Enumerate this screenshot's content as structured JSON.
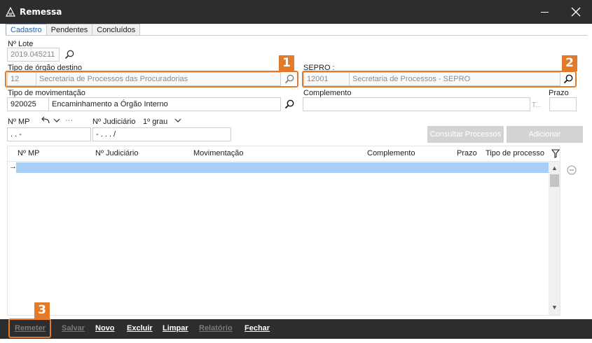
{
  "window": {
    "title": "Remessa"
  },
  "tabs": [
    "Cadastro",
    "Pendentes",
    "Concluídos"
  ],
  "lote": {
    "label": "Nº Lote",
    "value": "2019.045211"
  },
  "orgao": {
    "label": "Tipo de órgão destino",
    "code": "12",
    "name": "Secretaria de Processos das Procuradorias"
  },
  "sepro": {
    "label": "SEPRO :",
    "code": "12001",
    "name": "Secretaria de Processos - SEPRO"
  },
  "movimentacao": {
    "label": "Tipo de movimentação",
    "code": "920025",
    "name": "Encaminhamento a Órgão Interno"
  },
  "complemento": {
    "label": "Complemento",
    "hint": "T..."
  },
  "prazo": {
    "label": "Prazo"
  },
  "mp": {
    "label": "Nº MP",
    "mask": " .   .      -",
    "more": "···"
  },
  "judiciario": {
    "label": "Nº Judiciário",
    "grau": "1º grau",
    "mask": "          -  .  .  .   /"
  },
  "actions": {
    "consultar": "Consultar Processos",
    "adicionar": "Adicionar"
  },
  "grid": {
    "columns": [
      "Nº MP",
      "Nº Judiciário",
      "Movimentação",
      "Complemento",
      "Prazo",
      "Tipo de processo"
    ],
    "row_indicator": "→"
  },
  "callouts": [
    "1",
    "2",
    "3"
  ],
  "footer": {
    "remeter": "Remeter",
    "salvar": "Salvar",
    "novo": "Novo",
    "excluir": "Excluir",
    "limpar": "Limpar",
    "relatorio": "Relatório",
    "fechar": "Fechar"
  },
  "icons": {
    "app": "pyramid-icon",
    "search": "search-icon",
    "filter": "filter-icon",
    "remove": "minus-circle-icon"
  },
  "colors": {
    "titlebar": "#2d2d30",
    "highlight": "#e37a2a",
    "selection": "#a8cff4",
    "tab_active_text": "#2a63b8"
  }
}
